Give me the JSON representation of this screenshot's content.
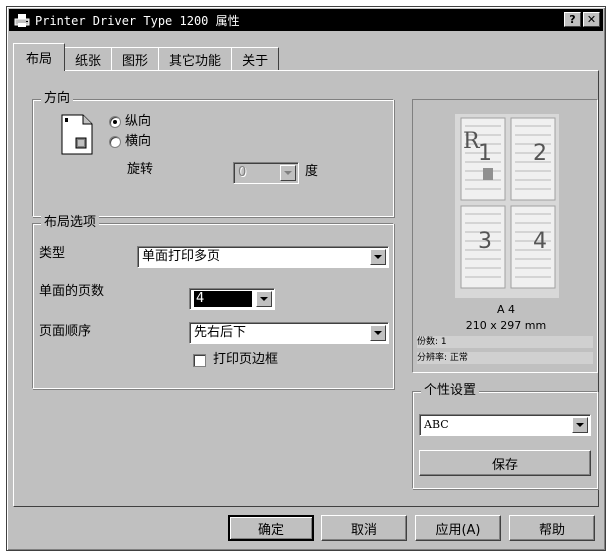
{
  "window": {
    "title": "Printer Driver Type 1200 属性",
    "help_label": "?",
    "close_label": "✕"
  },
  "tabs": [
    {
      "label": "布局",
      "active": true
    },
    {
      "label": "纸张",
      "active": false
    },
    {
      "label": "图形",
      "active": false
    },
    {
      "label": "其它功能",
      "active": false
    },
    {
      "label": "关于",
      "active": false
    }
  ],
  "orientation": {
    "title": "方向",
    "portrait_label": "纵向",
    "landscape_label": "横向",
    "selected": "portrait",
    "rotate_label": "旋转",
    "rotate_value": "0",
    "rotate_unit": "度"
  },
  "layout_options": {
    "title": "布局选项",
    "type_label": "类型",
    "type_value": "单面打印多页",
    "pages_label": "单面的页数",
    "pages_value": "4",
    "order_label": "页面顺序",
    "order_value": "先右后下",
    "border_label": "打印页边框",
    "border_checked": false
  },
  "preview": {
    "page_numbers": [
      "1",
      "2",
      "3",
      "4"
    ],
    "paper_name": "A 4",
    "paper_size": "210 x 297 mm",
    "copies_line": "份数: 1",
    "collate_line": "分辨率: 正常",
    "logo_letter": "R"
  },
  "profile": {
    "title": "个性设置",
    "value": "ABC",
    "save_label": "保存"
  },
  "footer": {
    "ok_label": "确定",
    "cancel_label": "取消",
    "apply_label": "应用(A)",
    "help_label": "帮助"
  }
}
